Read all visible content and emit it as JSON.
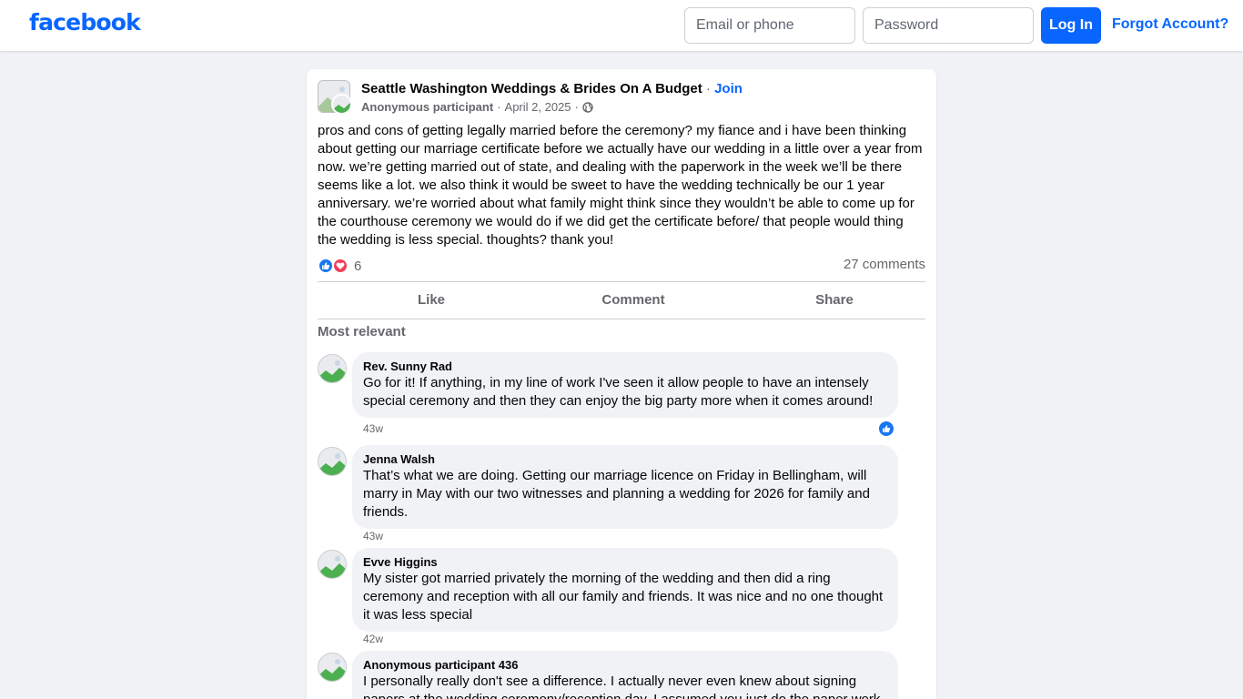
{
  "nav": {
    "logo": "facebook",
    "email_placeholder": "Email or phone",
    "password_placeholder": "Password",
    "login_label": "Log In",
    "forgot_label": "Forgot Account?"
  },
  "post": {
    "group_name": "Seattle Washington Weddings & Brides On A Budget",
    "separator": "·",
    "join_label": "Join",
    "author": "Anonymous participant",
    "date": "April 2, 2025",
    "body": "pros and cons of getting legally married before the ceremony? my fiance and i have been thinking about getting our marriage certificate before we actually have our wedding in a little over a year from now. we’re getting married out of state, and dealing with the paperwork in the week we’ll be there seems like a lot. we also think it would be sweet to have the wedding technically be our 1 year anniversary. we’re worried about what family might think since they wouldn’t be able to come up for the courthouse ceremony we would do if we did get the certificate before/ that people would thing the wedding is less special. thoughts? thank you!",
    "reaction_count": "6",
    "comments_count": "27 comments",
    "actions": {
      "like": "Like",
      "comment": "Comment",
      "share": "Share"
    },
    "sort_label": "Most relevant"
  },
  "comments": [
    {
      "name": "Rev. Sunny Rad",
      "text": "Go for it! If anything, in my line of work I've seen it allow people to have an intensely special ceremony and then they can enjoy the big party more when it comes around!",
      "time": "43w"
    },
    {
      "name": "Jenna Walsh",
      "text": "That’s what we are doing. Getting our marriage licence on Friday in Bellingham, will marry in May with our two witnesses and planning a wedding for 2026 for family and friends.",
      "time": "43w"
    },
    {
      "name": "Evve Higgins",
      "text": "My sister got married privately the morning of the wedding and then did a ring ceremony and reception with all our family and friends. It was nice and no one thought it was less special",
      "time": "42w"
    },
    {
      "name": "Anonymous participant 436",
      "text": "I personally really don't see a difference. I actually never even knew about signing papers at the wedding ceremony/reception day. I assumed you just do the paper work",
      "time": ""
    }
  ],
  "colors": {
    "brand_blue": "#0866ff",
    "page_bg": "#f0f2f5",
    "muted_text": "#65676b",
    "like_blue": "#1877f2",
    "love_red": "#f33e58"
  },
  "icons": [
    "globe-icon",
    "like-reaction-icon",
    "love-reaction-icon",
    "avatar-placeholder"
  ]
}
